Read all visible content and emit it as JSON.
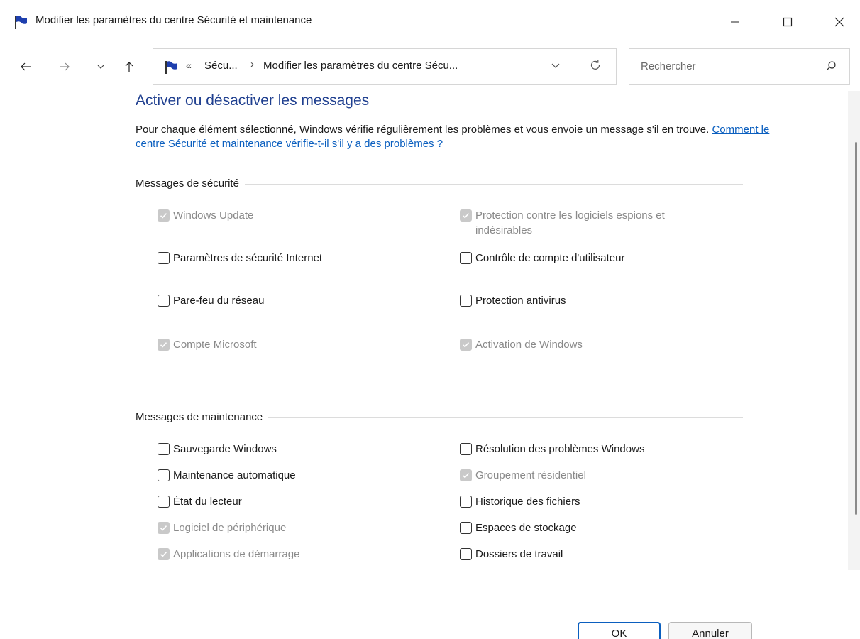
{
  "window": {
    "title": "Modifier les paramètres du centre Sécurité et maintenance",
    "minimize_glyph": "—",
    "maximize_glyph": "☐",
    "close_glyph": "✕"
  },
  "nav": {
    "back_icon": "arrow-left-icon",
    "forward_icon": "arrow-right-icon",
    "recent_icon": "chevron-down-icon",
    "up_icon": "arrow-up-icon"
  },
  "address": {
    "overflow": "«",
    "segment1": "Sécu...",
    "separator": "›",
    "segment2": "Modifier les paramètres du centre Sécu..."
  },
  "search": {
    "placeholder": "Rechercher"
  },
  "content": {
    "heading": "Activer ou désactiver les messages",
    "intro_text": "Pour chaque élément sélectionné, Windows vérifie régulièrement les problèmes et vous envoie un message s'il en trouve. ",
    "intro_link": "Comment le centre Sécurité et maintenance vérifie-t-il s'il y a des problèmes ?"
  },
  "security": {
    "title": "Messages de sécurité",
    "items": [
      {
        "label": "Windows Update",
        "checked": true,
        "disabled": true
      },
      {
        "label": "Protection contre les logiciels espions et indésirables",
        "checked": true,
        "disabled": true
      },
      {
        "label": "Paramètres de sécurité Internet",
        "checked": false,
        "disabled": false
      },
      {
        "label": "Contrôle de compte d'utilisateur",
        "checked": false,
        "disabled": false
      },
      {
        "label": "Pare-feu du réseau",
        "checked": false,
        "disabled": false
      },
      {
        "label": "Protection antivirus",
        "checked": false,
        "disabled": false
      },
      {
        "label": "Compte Microsoft",
        "checked": true,
        "disabled": true
      },
      {
        "label": "Activation de Windows",
        "checked": true,
        "disabled": true
      }
    ]
  },
  "maintenance": {
    "title": "Messages de maintenance",
    "items": [
      {
        "label": "Sauvegarde Windows",
        "checked": false,
        "disabled": false
      },
      {
        "label": "Résolution des problèmes Windows",
        "checked": false,
        "disabled": false
      },
      {
        "label": "Maintenance automatique",
        "checked": false,
        "disabled": false
      },
      {
        "label": "Groupement résidentiel",
        "checked": true,
        "disabled": true
      },
      {
        "label": "État du lecteur",
        "checked": false,
        "disabled": false
      },
      {
        "label": "Historique des fichiers",
        "checked": false,
        "disabled": false
      },
      {
        "label": "Logiciel de périphérique",
        "checked": true,
        "disabled": true
      },
      {
        "label": "Espaces de stockage",
        "checked": false,
        "disabled": false
      },
      {
        "label": "Applications de démarrage",
        "checked": true,
        "disabled": true
      },
      {
        "label": "Dossiers de travail",
        "checked": false,
        "disabled": false
      }
    ]
  },
  "buttons": {
    "ok": "OK",
    "cancel": "Annuler"
  },
  "colors": {
    "heading": "#1f3f8f",
    "link": "#0b5fbf",
    "flag": "#1e3fae"
  }
}
